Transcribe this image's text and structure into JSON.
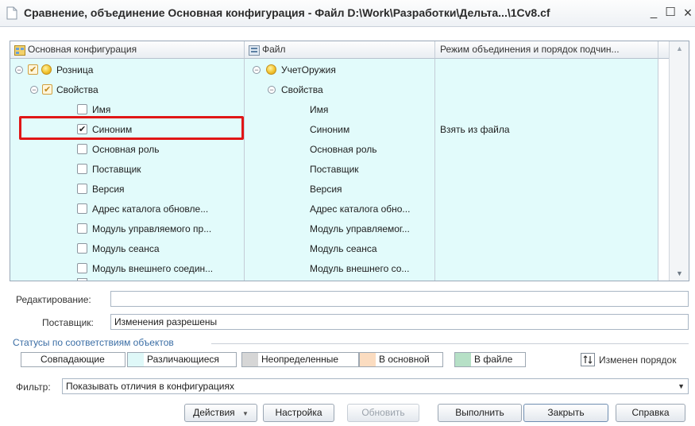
{
  "window": {
    "title": "Сравнение, объединение Основная конфигурация - Файл D:\\Work\\Разработки\\Дельта...\\1Cv8.cf",
    "minimize": "_",
    "maximize": "☐",
    "close": "×"
  },
  "columns": {
    "main_config": "Основная конфигурация",
    "file": "Файл",
    "merge_mode": "Режим объединения и порядок подчин..."
  },
  "tree": {
    "left": {
      "root": "Розница",
      "properties": "Свойства",
      "items": [
        "Имя",
        "Синоним",
        "Основная роль",
        "Поставщик",
        "Версия",
        "Адрес каталога обновле...",
        "Модуль управляемого пр...",
        "Модуль сеанса",
        "Модуль внешнего соедин..."
      ]
    },
    "right": {
      "root": "УчетОружия",
      "properties": "Свойства",
      "items": [
        "Имя",
        "Синоним",
        "Основная роль",
        "Поставщик",
        "Версия",
        "Адрес каталога обно...",
        "Модуль управляемог...",
        "Модуль сеанса",
        "Модуль внешнего со..."
      ]
    },
    "merge_mode_value": "Взять из файла"
  },
  "form": {
    "editing_label": "Редактирование:",
    "editing_value": "",
    "supplier_label": "Поставщик:",
    "supplier_value": "Изменения разрешены"
  },
  "legend": {
    "group_title": "Статусы по соответствиям объектов",
    "items": [
      {
        "label": "Совпадающие",
        "color": "#ffffff"
      },
      {
        "label": "Различающиеся",
        "color": "#dff8f8"
      },
      {
        "label": "Неопределенные",
        "color": "#d6d6d6"
      },
      {
        "label": "В основной",
        "color": "#fbdcc0"
      },
      {
        "label": "В файле",
        "color": "#b6e0c6"
      }
    ],
    "order_changed": "Изменен порядок"
  },
  "filter": {
    "label": "Фильтр:",
    "value": "Показывать отличия в конфигурациях"
  },
  "buttons": {
    "actions": "Действия",
    "settings": "Настройка",
    "refresh": "Обновить",
    "execute": "Выполнить",
    "close": "Закрыть",
    "help": "Справка"
  }
}
